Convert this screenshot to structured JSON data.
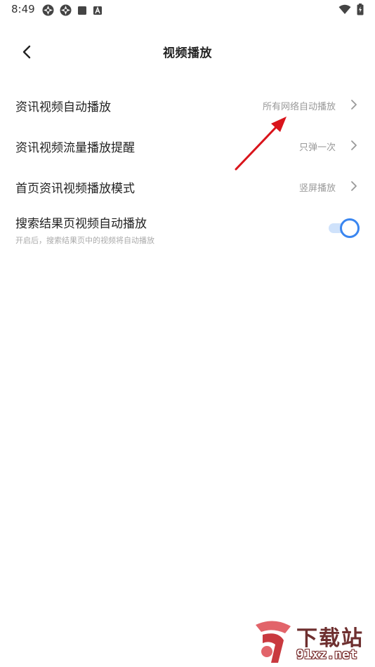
{
  "status_bar": {
    "time": "8:49",
    "left_icons": [
      "aperture-icon",
      "aperture-icon",
      "square-icon",
      "a-box-icon"
    ],
    "right_icons": [
      "wifi-icon",
      "battery-charging-icon"
    ]
  },
  "header": {
    "title": "视频播放",
    "back_icon": "chevron-left-icon"
  },
  "settings": {
    "items": [
      {
        "label": "资讯视频自动播放",
        "value": "所有网络自动播放"
      },
      {
        "label": "资讯视频流量播放提醒",
        "value": "只弹一次"
      },
      {
        "label": "首页资讯视频播放模式",
        "value": "竖屏播放"
      }
    ],
    "search_autoplay": {
      "label": "搜索结果页视频自动播放",
      "description": "开启后，搜索结果页中的视频将自动播放",
      "enabled": true
    }
  },
  "colors": {
    "toggle_accent": "#3a86f0",
    "toggle_track": "#cfe2fb",
    "arrow": "#d9141b"
  },
  "watermark": {
    "title": "下载站",
    "url": "91xz.net"
  }
}
